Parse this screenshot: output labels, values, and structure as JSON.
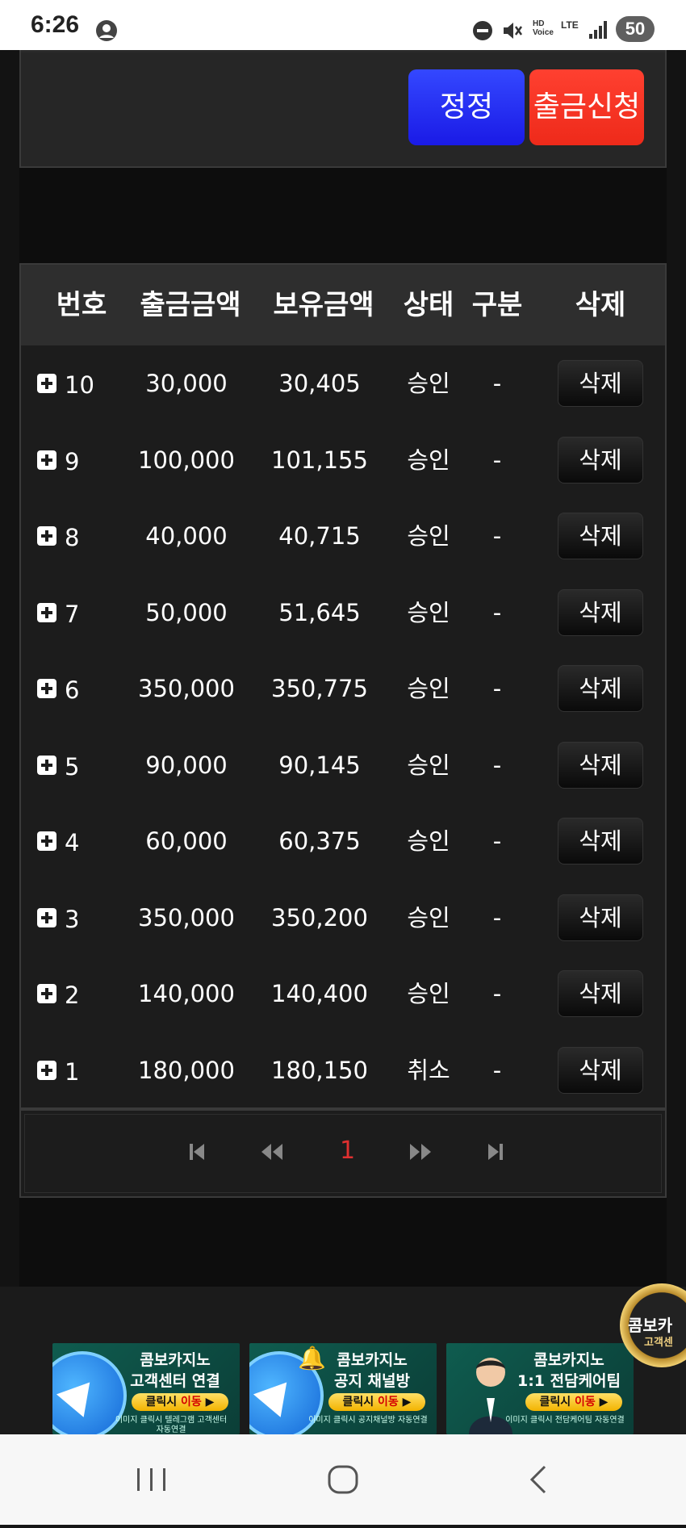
{
  "status_bar": {
    "time": "6:26",
    "hd_label": "HD",
    "voice_label": "Voice",
    "lte_label": "LTE",
    "battery": "50"
  },
  "top_panel": {
    "edit_label": "정정",
    "request_label": "출금신청"
  },
  "table": {
    "headers": {
      "no": "번호",
      "amount": "출금금액",
      "balance": "보유금액",
      "status": "상태",
      "type": "구분",
      "delete": "삭제"
    },
    "rows": [
      {
        "no": "10",
        "amount": "30,000",
        "balance": "30,405",
        "status": "승인",
        "type": "-",
        "delete": "삭제"
      },
      {
        "no": "9",
        "amount": "100,000",
        "balance": "101,155",
        "status": "승인",
        "type": "-",
        "delete": "삭제"
      },
      {
        "no": "8",
        "amount": "40,000",
        "balance": "40,715",
        "status": "승인",
        "type": "-",
        "delete": "삭제"
      },
      {
        "no": "7",
        "amount": "50,000",
        "balance": "51,645",
        "status": "승인",
        "type": "-",
        "delete": "삭제"
      },
      {
        "no": "6",
        "amount": "350,000",
        "balance": "350,775",
        "status": "승인",
        "type": "-",
        "delete": "삭제"
      },
      {
        "no": "5",
        "amount": "90,000",
        "balance": "90,145",
        "status": "승인",
        "type": "-",
        "delete": "삭제"
      },
      {
        "no": "4",
        "amount": "60,000",
        "balance": "60,375",
        "status": "승인",
        "type": "-",
        "delete": "삭제"
      },
      {
        "no": "3",
        "amount": "350,000",
        "balance": "350,200",
        "status": "승인",
        "type": "-",
        "delete": "삭제"
      },
      {
        "no": "2",
        "amount": "140,000",
        "balance": "140,400",
        "status": "승인",
        "type": "-",
        "delete": "삭제"
      },
      {
        "no": "1",
        "amount": "180,000",
        "balance": "180,150",
        "status": "취소",
        "type": "-",
        "delete": "삭제"
      }
    ]
  },
  "pagination": {
    "current_page": "1"
  },
  "banners": [
    {
      "line1": "콤보카지노",
      "line2": "고객센터 연결",
      "cta_prefix": "클릭시 ",
      "cta_highlight": "이동",
      "sub": "이미지 클릭시 텔레그램 고객센터 자동연결"
    },
    {
      "line1": "콤보카지노",
      "line2": "공지 채널방",
      "cta_prefix": "클릭시 ",
      "cta_highlight": "이동",
      "sub": "이미지 클릭시 공지채널방 자동연결"
    },
    {
      "line1": "콤보카지노",
      "line2": "1:1 전담케어팀",
      "cta_prefix": "클릭시 ",
      "cta_highlight": "이동",
      "sub": "이미지 클릭시 전담케어팀 자동연결"
    }
  ],
  "floating_badge": {
    "line1": "콤보카",
    "line2": "고객센"
  },
  "icons": {
    "dnd": "do-not-disturb-icon",
    "mute": "mute-icon",
    "signal": "signal-icon",
    "first": "first-page-icon",
    "prev": "prev-page-icon",
    "next": "next-page-icon",
    "last": "last-page-icon"
  },
  "colors": {
    "edit_button": "#2222ee",
    "request_button": "#f02a1a",
    "current_page": "#e03030"
  }
}
